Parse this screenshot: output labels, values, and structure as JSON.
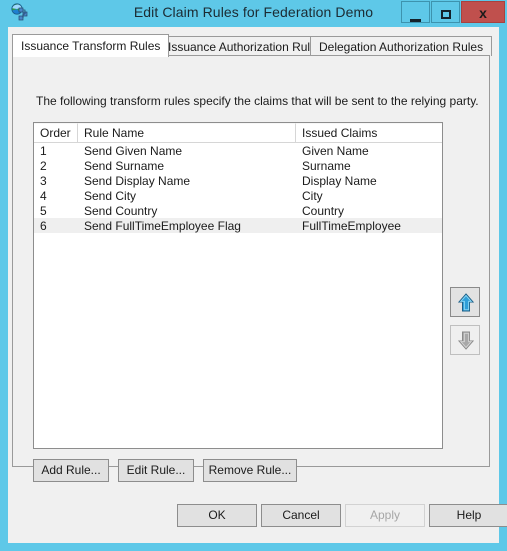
{
  "window": {
    "title": "Edit Claim Rules for Federation Demo",
    "icon": "federation-globe-icon",
    "controls": {
      "minimize_label": "—",
      "maximize_label": "□",
      "close_label": "x"
    },
    "colors": {
      "titlebar": "#5ec8e8",
      "close_button": "#c0504d",
      "dialog_background": "#f0f0f0",
      "list_background": "#ffffff",
      "selection": "#efefef",
      "arrow_enabled": "#2f9fd8",
      "arrow_disabled": "#9a9a9a"
    }
  },
  "tabs": [
    {
      "label": "Issuance Transform Rules",
      "active": true
    },
    {
      "label": "Issuance Authorization Rules",
      "active": false
    },
    {
      "label": "Delegation Authorization Rules",
      "active": false
    }
  ],
  "panel": {
    "description": "The following transform rules specify the claims that will be sent to the relying party."
  },
  "list": {
    "columns": [
      "Order",
      "Rule Name",
      "Issued Claims"
    ],
    "rows": [
      {
        "order": "1",
        "rule": "Send Given Name",
        "claim": "Given Name",
        "selected": false
      },
      {
        "order": "2",
        "rule": "Send Surname",
        "claim": "Surname",
        "selected": false
      },
      {
        "order": "3",
        "rule": "Send Display Name",
        "claim": "Display Name",
        "selected": false
      },
      {
        "order": "4",
        "rule": "Send City",
        "claim": "City",
        "selected": false
      },
      {
        "order": "5",
        "rule": "Send Country",
        "claim": "Country",
        "selected": false
      },
      {
        "order": "6",
        "rule": "Send FullTimeEmployee Flag",
        "claim": "FullTimeEmployee",
        "selected": true
      }
    ]
  },
  "order_buttons": {
    "move_up": {
      "icon": "arrow-up-icon",
      "enabled": true
    },
    "move_down": {
      "icon": "arrow-down-icon",
      "enabled": false
    }
  },
  "rule_buttons": {
    "add": "Add Rule...",
    "edit": "Edit Rule...",
    "remove": "Remove Rule..."
  },
  "footer_buttons": {
    "ok": "OK",
    "cancel": "Cancel",
    "apply": "Apply",
    "help": "Help",
    "apply_enabled": false
  }
}
